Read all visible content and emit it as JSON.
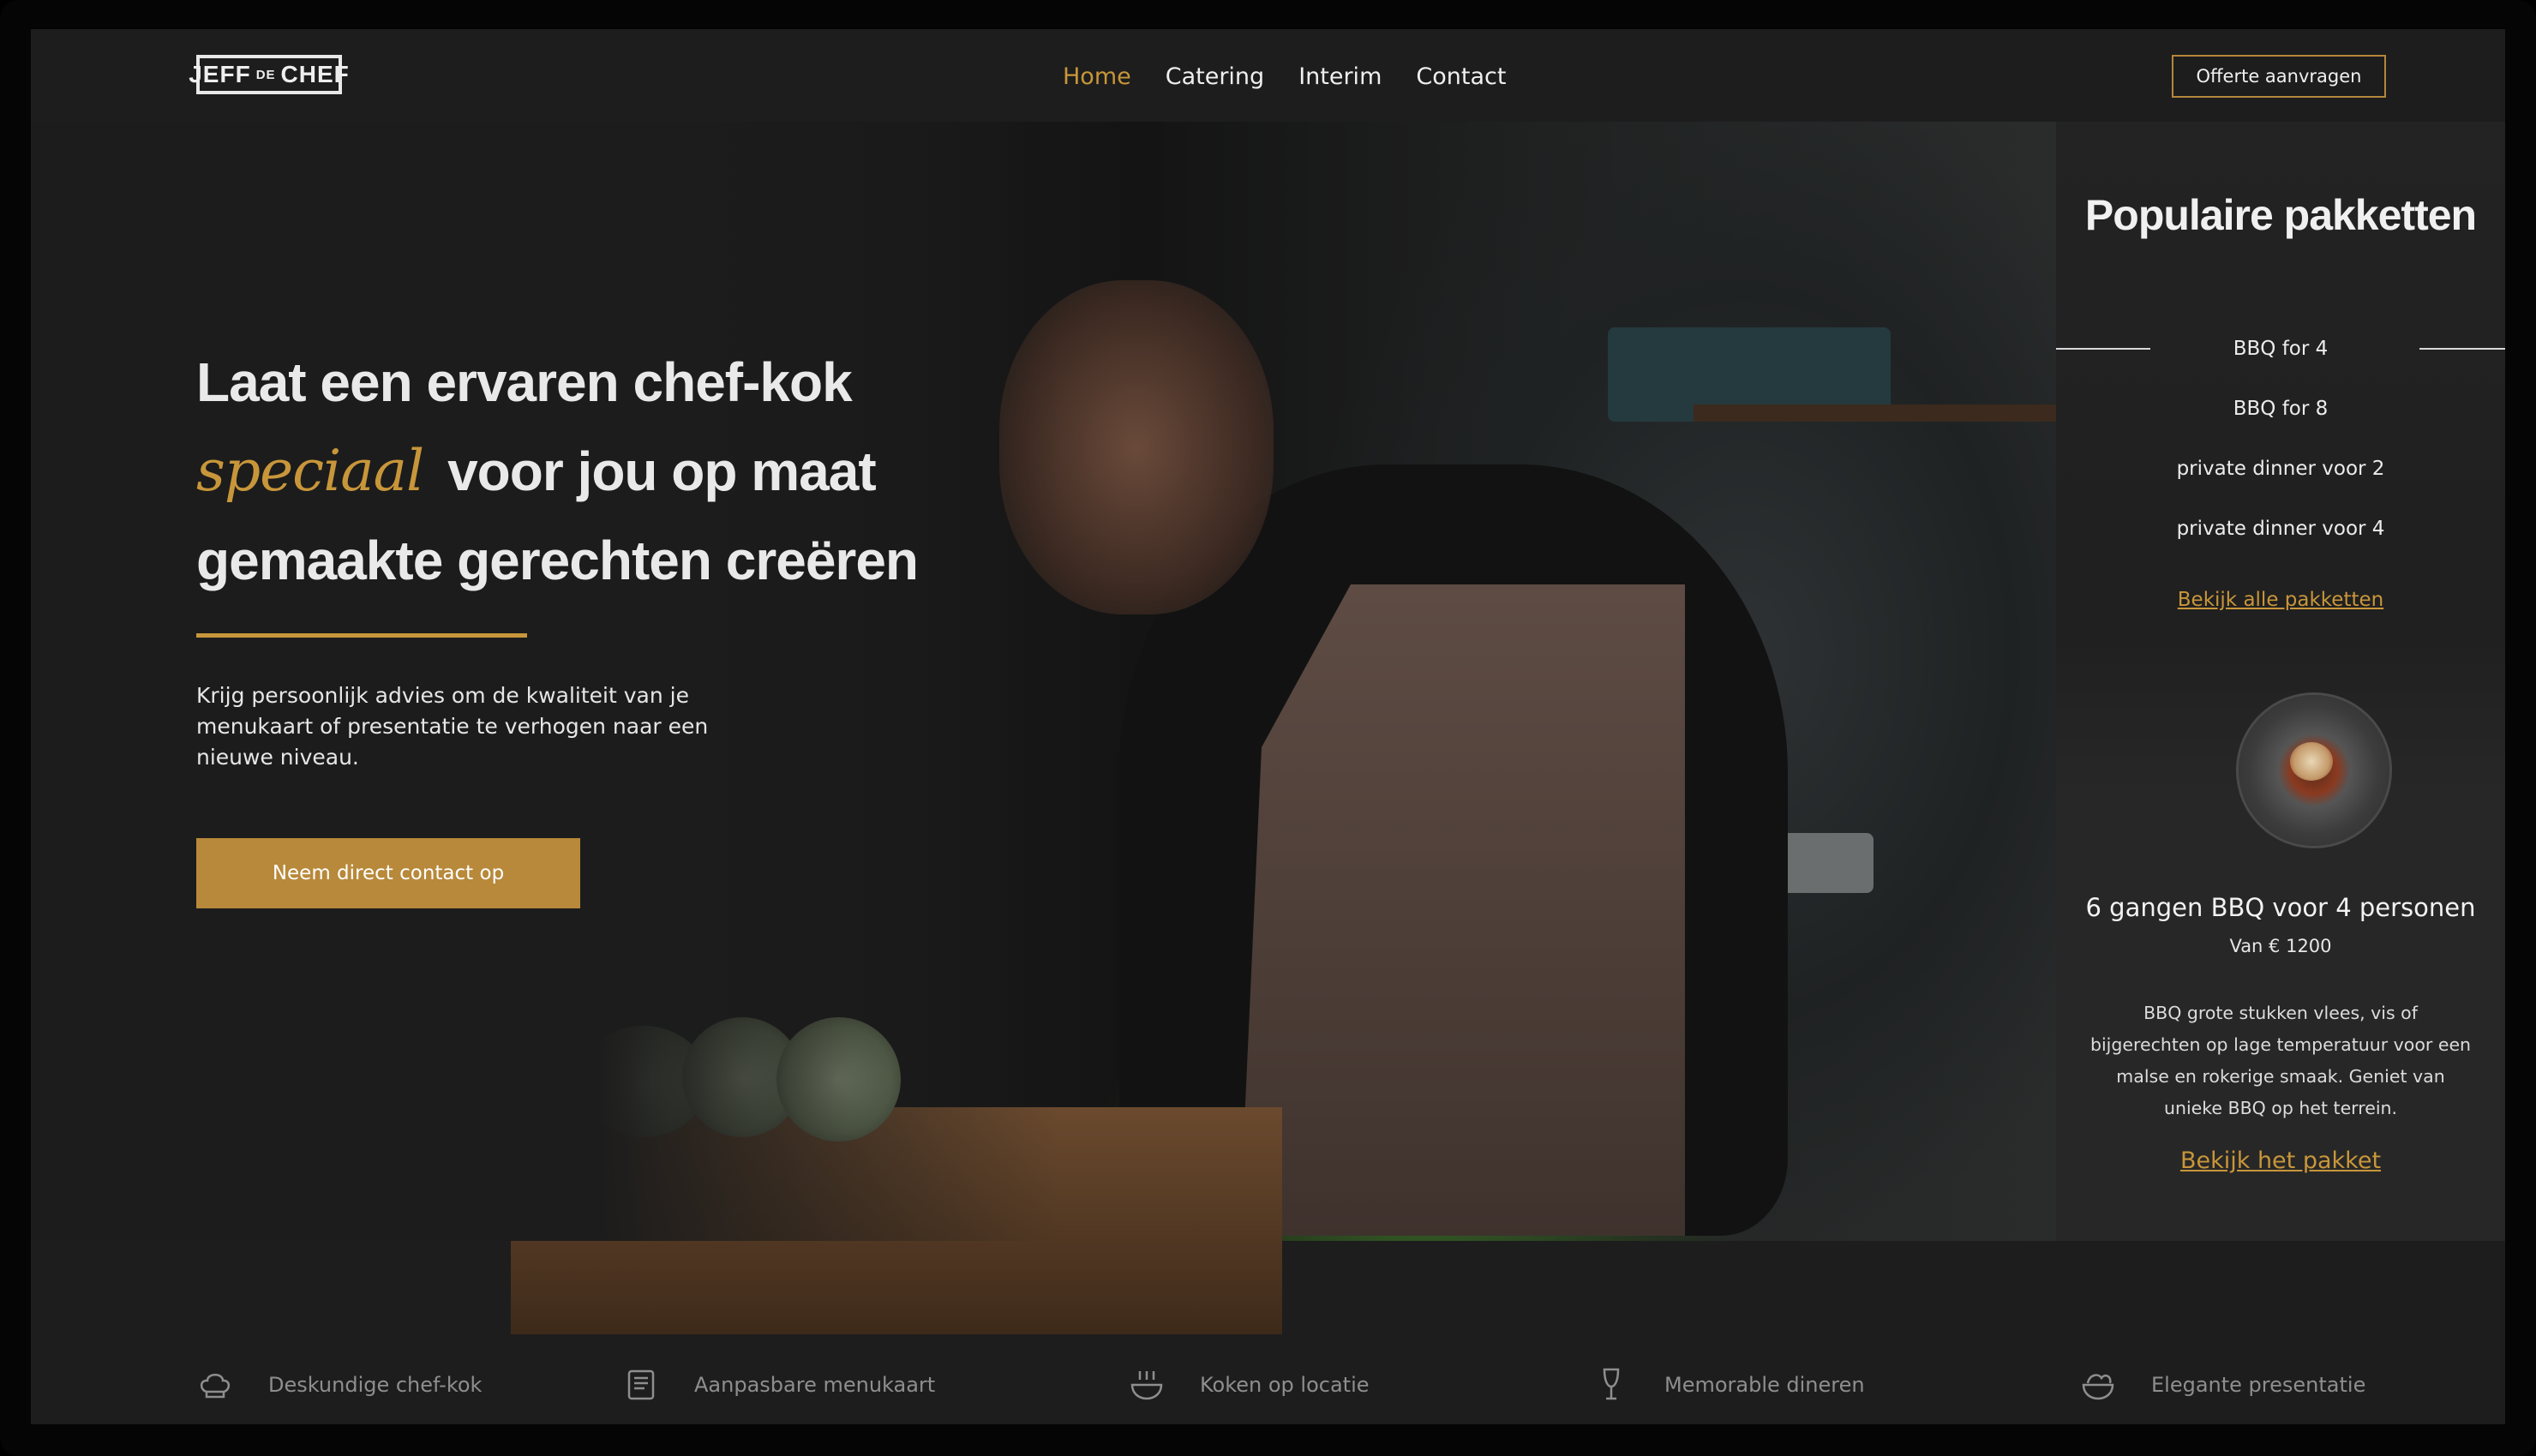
{
  "brand": {
    "logo_main": "JEFF",
    "logo_de": "DE",
    "logo_end": "CHEF"
  },
  "nav": {
    "items": [
      {
        "label": "Home",
        "active": true
      },
      {
        "label": "Catering",
        "active": false
      },
      {
        "label": "Interim",
        "active": false
      },
      {
        "label": "Contact",
        "active": false
      }
    ],
    "cta": "Offerte aanvragen"
  },
  "hero": {
    "line1": "Laat een ervaren chef-kok",
    "line2_script": "speciaal",
    "line2_rest": "voor jou op maat",
    "line3": "gemaakte gerechten creëren",
    "lead": "Krijg persoonlijk advies om de kwaliteit van je menukaart of presentatie te verhogen naar een nieuwe niveau.",
    "cta": "Neem direct contact op"
  },
  "panel": {
    "title": "Populaire pakketten",
    "packages": [
      "BBQ for 4",
      "BBQ for 8",
      "private dinner voor 2",
      "private dinner voor 4"
    ],
    "all_link": "Bekijk alle pakketten",
    "featured": {
      "title": "6 gangen BBQ voor 4 personen",
      "price": "Van € 1200",
      "description": "BBQ grote stukken vlees, vis of bijgerechten op lage temperatuur voor een malse en rokerige smaak. Geniet van unieke BBQ op het terrein.",
      "link": "Bekijk het pakket"
    }
  },
  "features": [
    {
      "icon": "chef-hat-icon",
      "label": "Deskundige chef-kok"
    },
    {
      "icon": "menu-card-icon",
      "label": "Aanpasbare menukaart"
    },
    {
      "icon": "steaming-bowl-icon",
      "label": "Koken op locatie"
    },
    {
      "icon": "wine-glass-icon",
      "label": "Memorable dineren"
    },
    {
      "icon": "salad-bowl-icon",
      "label": "Elegante presentatie"
    }
  ],
  "colors": {
    "accent": "#c8963a",
    "background": "#1d1d1d",
    "panel": "#272727"
  }
}
